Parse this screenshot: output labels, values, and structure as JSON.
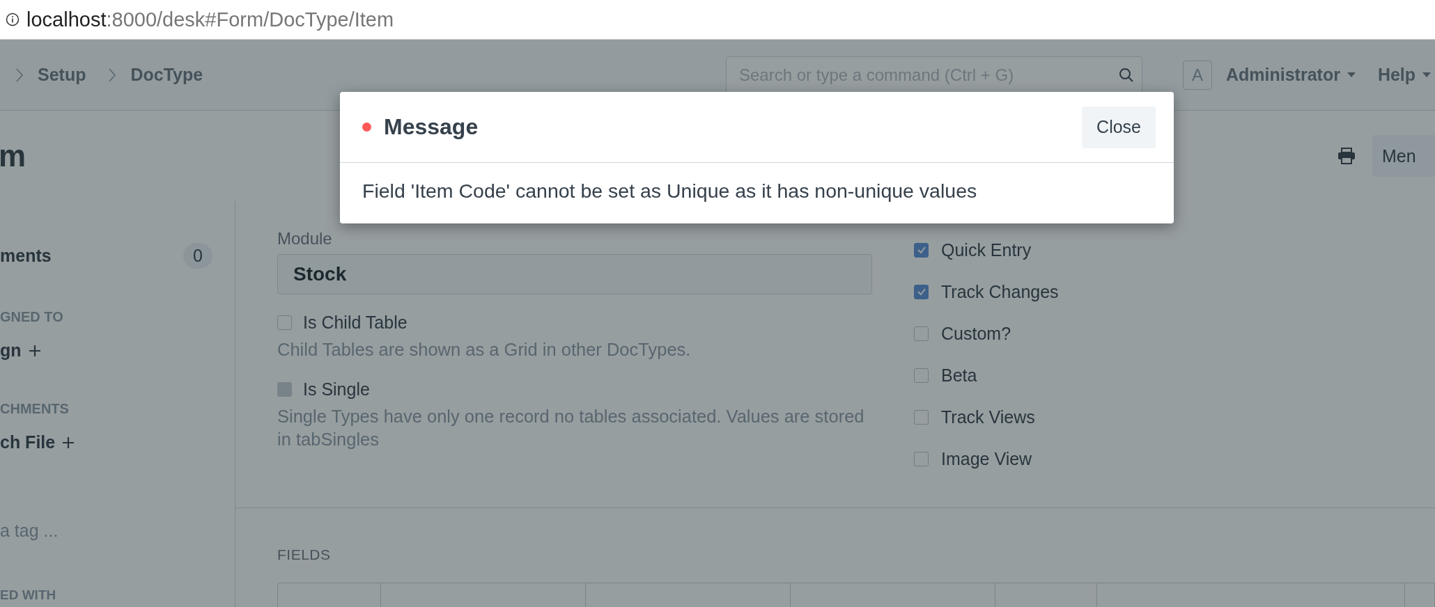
{
  "address_bar": {
    "host": "localhost",
    "path": ":8000/desk#Form/DocType/Item"
  },
  "navbar": {
    "breadcrumbs": [
      "Setup",
      "DocType"
    ],
    "search": {
      "placeholder": "Search or type a command (Ctrl + G)"
    },
    "avatar": "A",
    "user": "Administrator",
    "help": "Help"
  },
  "page_head": {
    "title": "m",
    "menu_button": "Men"
  },
  "sidebar": {
    "items": [
      {
        "kind": "count",
        "label": "ments",
        "count": "0"
      },
      {
        "kind": "heading",
        "label": "GNED TO"
      },
      {
        "kind": "add",
        "label": "gn"
      },
      {
        "kind": "heading",
        "label": "CHMENTS"
      },
      {
        "kind": "add",
        "label": "ch File"
      },
      {
        "kind": "tag",
        "label": "a tag ..."
      },
      {
        "kind": "heading",
        "label": "ED WITH"
      }
    ]
  },
  "form": {
    "module": {
      "label": "Module",
      "value": "Stock"
    },
    "left_checks": [
      {
        "label": "Is Child Table",
        "checked": false,
        "disabled": false,
        "description": "Child Tables are shown as a Grid in other DocTypes."
      },
      {
        "label": "Is Single",
        "checked": false,
        "disabled": true,
        "description": "Single Types have only one record no tables associated. Values are stored in tabSingles"
      }
    ],
    "right_checks": [
      {
        "label": "Quick Entry",
        "checked": true
      },
      {
        "label": "Track Changes",
        "checked": true
      },
      {
        "label": "Custom?",
        "checked": false
      },
      {
        "label": "Beta",
        "checked": false
      },
      {
        "label": "Track Views",
        "checked": false
      },
      {
        "label": "Image View",
        "checked": false
      }
    ]
  },
  "fields_section": {
    "title": "FIELDS"
  },
  "dialog": {
    "title": "Message",
    "color": "#ff5858",
    "close": "Close",
    "message": "Field 'Item Code' cannot be set as Unique as it has non-unique values"
  }
}
